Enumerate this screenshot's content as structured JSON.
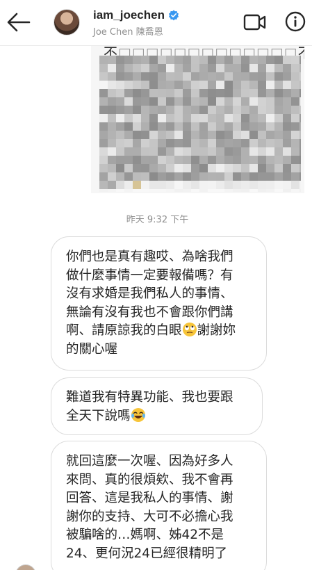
{
  "header": {
    "username": "iam_joechen",
    "full_name": "Joe Chen 陳喬恩",
    "icons": {
      "back": "arrow-left-icon",
      "verified": "verified-badge-icon",
      "video": "video-call-icon",
      "info": "info-icon"
    },
    "accent_color": "#3897f0"
  },
  "shared_image": {
    "visible_text_start": "不",
    "visible_text_end": "不能"
  },
  "timestamp": "昨天 9:32 下午",
  "messages": [
    {
      "text": "你們也是真有趣哎、為啥我們\n做什麼事情一定要報備嗎？有\n沒有求婚是我們私人的事情、\n無論有沒有我也不會跟你們講\n啊、請原諒我的白眼",
      "emoji": "eye-roll-emoji",
      "text_after": "謝謝妳\n的關心喔"
    },
    {
      "text": "難道我有特異功能、我也要跟\n全天下說嗎",
      "emoji": "tears-of-joy-emoji"
    },
    {
      "text": "就回這麼一次喔、因為好多人\n來問、真的很煩欸、我不會再\n回答、這是我私人的事情、謝\n謝你的支持、大可不必擔心我\n被騙啥的…媽啊、姊42不是\n24、更何況24已經很精明了"
    }
  ]
}
